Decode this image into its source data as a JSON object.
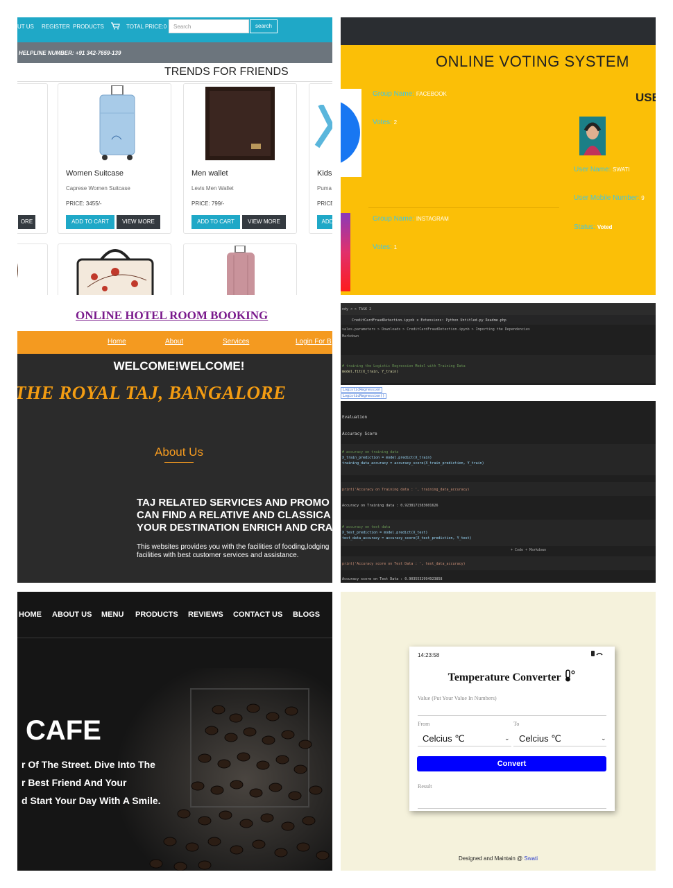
{
  "shop": {
    "nav": [
      "UT US",
      "REGISTER",
      "PRODUCTS",
      "TOTAL PRICE:0"
    ],
    "search_placeholder": "Search",
    "search_button": "search",
    "helpline": "HELPLINE NUMBER: +91 342-7659-139",
    "heading": "TRENDS FOR FRIENDS",
    "left_button_fragment": "ORE",
    "products": [
      {
        "name": "Women Suitcase",
        "desc": "Caprese Women Suitcase",
        "price": "PRICE: 3455/-"
      },
      {
        "name": "Men wallet",
        "desc": "Levis Men Wallet",
        "price": "PRICE: 799/-"
      },
      {
        "name": "Kids",
        "desc": "Puma",
        "price": "PRICE"
      }
    ],
    "add_to_cart": "ADD TO CART",
    "add_fragment": "ADD",
    "view_more": "VIEW MORE"
  },
  "voting": {
    "title": "ONLINE VOTING SYSTEM",
    "user_heading_fragment": "USE",
    "group1_label": "Group Name:",
    "group1_value": "FACEBOOK",
    "votes1_label": "Votes:",
    "votes1_value": "2",
    "group2_label": "Group Name:",
    "group2_value": "INSTAGRAM",
    "votes2_label": "Votes:",
    "votes2_value": "1",
    "user_name_label": "User Name:",
    "user_name_value": "SWATI",
    "user_mobile_label": "User Mobile Number:",
    "user_mobile_value": "9",
    "status_label": "Status:",
    "status_value": "Voted"
  },
  "hotel": {
    "title": "ONLINE HOTEL ROOM BOOKING",
    "nav": [
      "Home",
      "About",
      "Services",
      "Login For B"
    ],
    "welcome": "WELCOME!WELCOME!",
    "name": "THE ROYAL TAJ, BANGALORE",
    "about_heading": "About Us",
    "about_lines": [
      "TAJ RELATED SERVICES AND PROMO",
      "CAN FIND A RELATIVE AND CLASSICA",
      "YOUR DESTINATION ENRICH AND CRA"
    ],
    "desc_lines": [
      "This websites provides you with the facilities of fooding,lodging",
      "facilities with best customer services and assistance."
    ]
  },
  "code": {
    "lines": [
      {
        "text": "ndy   <   >                              TASK 2",
        "color": "#bbbbbb"
      },
      {
        "text": "CreditCardFraudDetection.ipynb  x    Extensions: Python    Untitled.py    Readme.php",
        "color": "#cccccc"
      },
      {
        "text": "sales.parameters > Downloads > CreditCardFraudDetection.ipynb > Importing the Dependencies",
        "color": "#aaaaaa"
      },
      {
        "text": "Markdown",
        "color": "#aaaaaa"
      },
      {
        "text": "# training the Logistic Regression Model with Training Data",
        "color": "#6a9955"
      },
      {
        "text": "model.fit(X_train, Y_train)",
        "color": "#dcdcaa"
      },
      {
        "text": "Evaluation",
        "color": "#dddddd"
      },
      {
        "text": "Accuracy Score",
        "color": "#dddddd"
      },
      {
        "text": "# accuracy on training data",
        "color": "#6a9955"
      },
      {
        "text": "X_train_prediction = model.predict(X_train)",
        "color": "#9cdcfe"
      },
      {
        "text": "training_data_accuracy = accuracy_score(X_train_prediction, Y_train)",
        "color": "#9cdcfe"
      },
      {
        "text": "print('Accuracy on Training data : ', training_data_accuracy)",
        "color": "#ce9178"
      },
      {
        "text": "Accuracy on Training data :  0.9238171583601626",
        "color": "#cccccc"
      },
      {
        "text": "# accuracy on test data",
        "color": "#6a9955"
      },
      {
        "text": "X_test_prediction = model.predict(X_test)",
        "color": "#9cdcfe"
      },
      {
        "text": "test_data_accuracy = accuracy_score(X_test_prediction, Y_test)",
        "color": "#9cdcfe"
      },
      {
        "text": "+ Code   + Markdown",
        "color": "#aaaaaa"
      },
      {
        "text": "print('Accuracy score on Test Data : ', test_data_accuracy)",
        "color": "#ce9178"
      },
      {
        "text": "Accuracy score on Test Data :  0.9035532994923858",
        "color": "#cccccc"
      }
    ],
    "gap_items": [
      "LogisticRegression",
      "LogisticRegression()"
    ]
  },
  "cafe": {
    "nav": [
      "HOME",
      "ABOUT US",
      "MENU",
      "PRODUCTS",
      "REVIEWS",
      "CONTACT US",
      "BLOGS"
    ],
    "title": "CAFE",
    "lines": [
      "r Of The Street. Dive Into The",
      "r Best Friend And Your",
      "d Start Your Day With A Smile."
    ]
  },
  "temp": {
    "time": "14:23:58",
    "title": "Temperature Converter",
    "value_label": "Value (Put Your Value In Numbers)",
    "from_label": "From",
    "to_label": "To",
    "from_value": "Celcius ℃",
    "to_value": "Celcius ℃",
    "convert": "Convert",
    "result_label": "Result",
    "footer_prefix": "Designed and Maintain @",
    "footer_name": "Swati"
  }
}
